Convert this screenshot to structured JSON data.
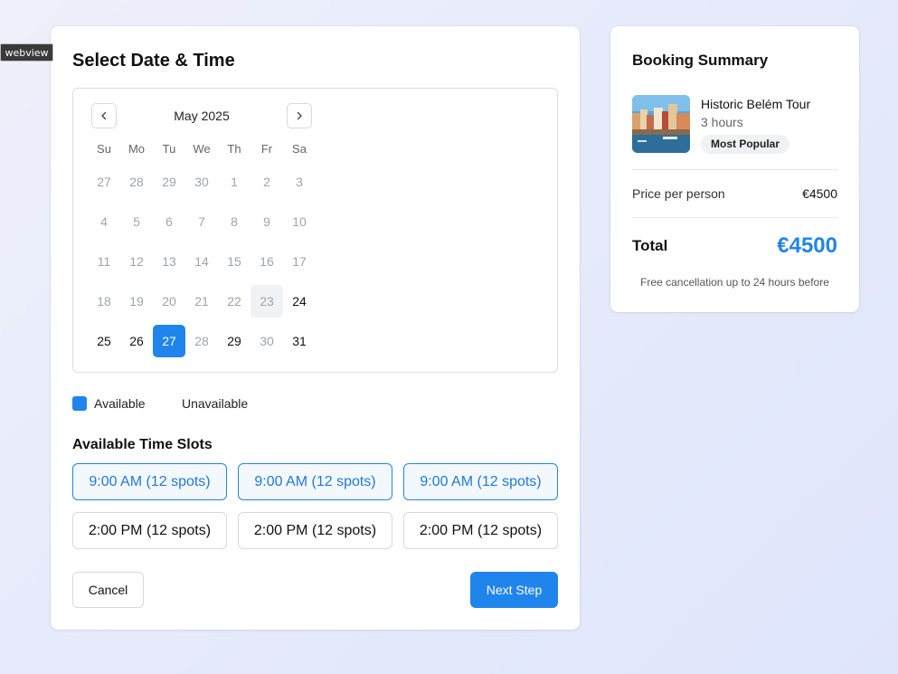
{
  "webview_label": "webview",
  "booking": {
    "title": "Select Date & Time",
    "calendar": {
      "month": "May 2025",
      "weekdays": [
        "Su",
        "Mo",
        "Tu",
        "We",
        "Th",
        "Fr",
        "Sa"
      ],
      "weeks": [
        [
          "27",
          "28",
          "29",
          "30",
          "1",
          "2",
          "3"
        ],
        [
          "4",
          "5",
          "6",
          "7",
          "8",
          "9",
          "10"
        ],
        [
          "11",
          "12",
          "13",
          "14",
          "15",
          "16",
          "17"
        ],
        [
          "18",
          "19",
          "20",
          "21",
          "22",
          "23",
          "24"
        ],
        [
          "25",
          "26",
          "27",
          "28",
          "29",
          "30",
          "31"
        ]
      ],
      "available_days": [
        "24",
        "25",
        "26",
        "29",
        "31"
      ],
      "today": "23",
      "selected": "27",
      "prev_icon": "chevron-left-icon",
      "next_icon": "chevron-right-icon"
    },
    "legend": {
      "available": "Available",
      "unavailable": "Unavailable"
    },
    "slots_title": "Available Time Slots",
    "slots": [
      "9:00 AM (12 spots)",
      "9:00 AM (12 spots)",
      "9:00 AM (12 spots)",
      "2:00 PM (12 spots)",
      "2:00 PM (12 spots)",
      "2:00 PM (12 spots)"
    ],
    "cancel_label": "Cancel",
    "next_label": "Next Step"
  },
  "summary": {
    "title": "Booking Summary",
    "tour_name": "Historic Belém Tour",
    "duration": "3 hours",
    "badge": "Most Popular",
    "price_label": "Price per person",
    "price_value": "€4500",
    "total_label": "Total",
    "total_value": "€4500",
    "cancellation_note": "Free cancellation up to 24 hours before"
  },
  "colors": {
    "accent": "#1f85ec",
    "muted_day": "#a0a3a8"
  }
}
